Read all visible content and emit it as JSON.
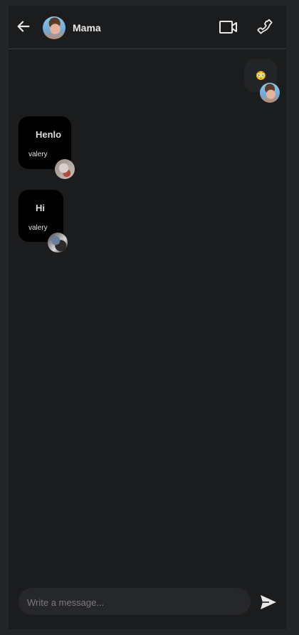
{
  "header": {
    "contact_name": "Mama",
    "icons": {
      "back": "arrow-left-icon",
      "video": "video-camera-icon",
      "call": "phone-icon"
    }
  },
  "messages": [
    {
      "direction": "outgoing",
      "text": "😳"
    },
    {
      "direction": "incoming",
      "text": "Henlo",
      "sender": "valery"
    },
    {
      "direction": "incoming",
      "text": "Hi",
      "sender": "valery"
    }
  ],
  "composer": {
    "placeholder": "Write a message...",
    "value": "",
    "send_icon": "send-icon"
  },
  "colors": {
    "background": "#1b1c1d",
    "bubble_incoming": "#000000",
    "bubble_outgoing": "#232425",
    "text": "#e8e8e8"
  }
}
